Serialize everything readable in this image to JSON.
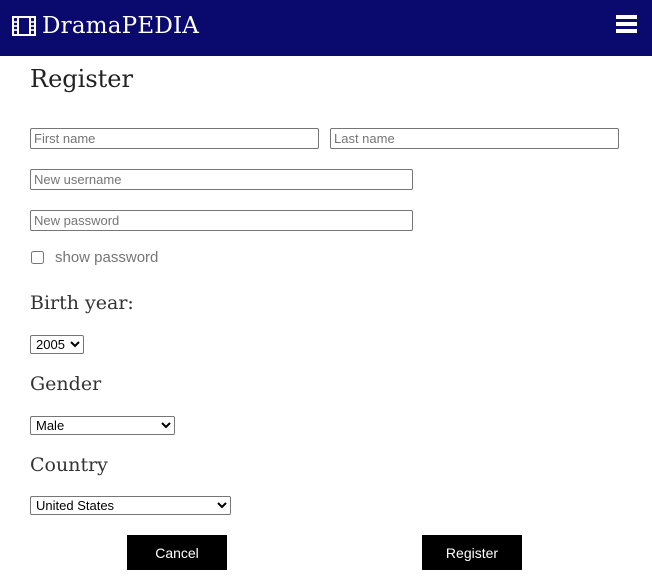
{
  "header": {
    "brand": "DramaPEDIA",
    "brand_icon": "film-icon",
    "menu_icon": "hamburger-icon",
    "background": "#0a0a6e"
  },
  "form": {
    "title": "Register",
    "first_name_placeholder": "First name",
    "last_name_placeholder": "Last name",
    "username_placeholder": "New username",
    "password_placeholder": "New password",
    "show_password_label": "show password",
    "show_password_checked": false,
    "birth_year_label": "Birth year:",
    "birth_year_value": "2005",
    "gender_label": "Gender",
    "gender_value": "Male",
    "country_label": "Country",
    "country_value": "United States",
    "cancel_label": "Cancel",
    "register_label": "Register"
  },
  "colors": {
    "header_bg": "#0a0a6e",
    "button_bg": "#000000",
    "button_text": "#ffffff"
  }
}
